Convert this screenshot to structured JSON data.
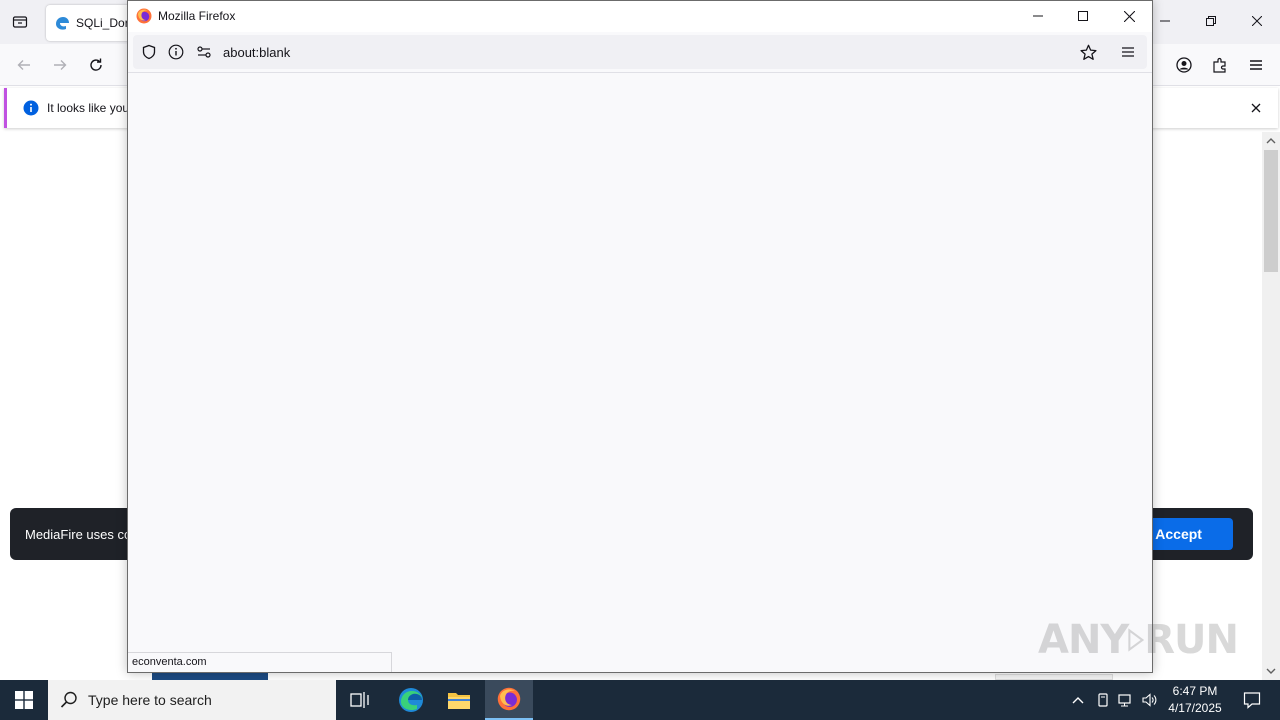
{
  "background_window": {
    "tab": {
      "title": "SQLi_Dork"
    },
    "notification": {
      "text": "It looks like you"
    },
    "cookie_banner": {
      "text": "MediaFire uses co",
      "accept_label": "l Accept"
    }
  },
  "popup": {
    "title": "Mozilla Firefox",
    "url": "about:blank",
    "status": "econventa.com"
  },
  "taskbar": {
    "search_placeholder": "Type here to search",
    "time": "6:47 PM",
    "date": "4/17/2025"
  },
  "watermark": {
    "text_a": "ANY",
    "text_b": "RUN"
  },
  "colors": {
    "taskbar_bg": "#1b2a3a",
    "cookie_bg": "#1f2228",
    "accept_blue": "#0a6ce8",
    "notif_accent": "#c052e1",
    "firefox_orange": "#ff7139"
  }
}
